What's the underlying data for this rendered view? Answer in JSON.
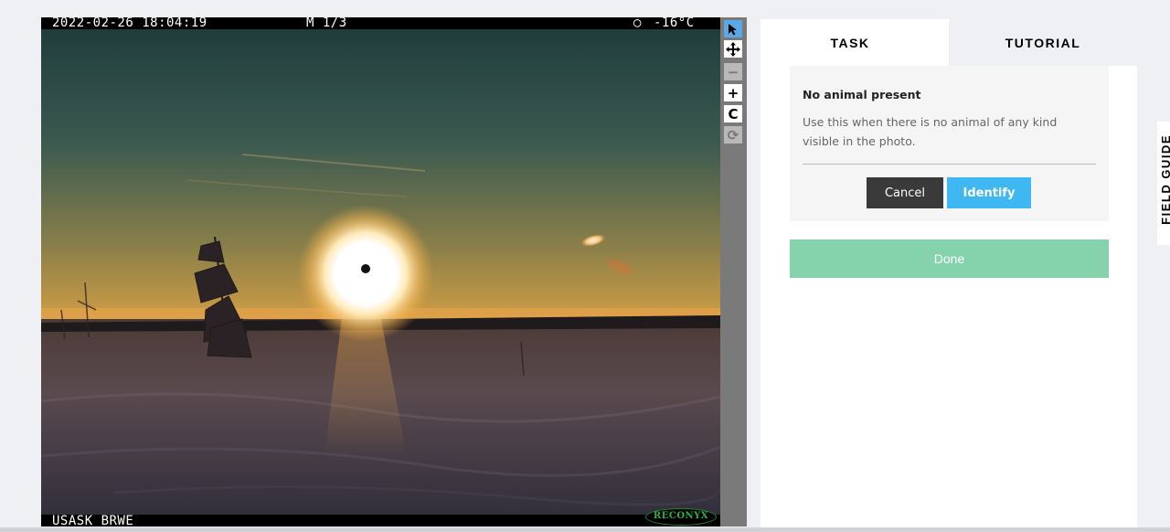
{
  "camera": {
    "datetime": "2022-02-26 18:04:19",
    "frame": "M 1/3",
    "moon_phase_glyph": "○",
    "temperature": "-16°C",
    "site": "USASK BRWE",
    "brand": "RECONYX"
  },
  "toolbar": {
    "annotate_icon": "cursor-arrow-icon",
    "move_icon": "move-icon",
    "zoom_out_icon": "minus-icon",
    "zoom_in_icon": "plus-icon",
    "rotate_icon": "rotate-icon",
    "reset_icon": "reset-icon"
  },
  "tabs": [
    {
      "label": "TASK",
      "active": true
    },
    {
      "label": "TUTORIAL",
      "active": false
    }
  ],
  "choice": {
    "title": "No animal present",
    "description": "Use this when there is no animal of any kind visible in the photo.",
    "cancel_label": "Cancel",
    "identify_label": "Identify"
  },
  "done_label": "Done",
  "field_guide_label": "FIELD GUIDE",
  "colors": {
    "identify": "#3fb7f2",
    "done": "#84d3ad",
    "cancel": "#3a3a3a",
    "active_tool": "#5aa9e6"
  }
}
